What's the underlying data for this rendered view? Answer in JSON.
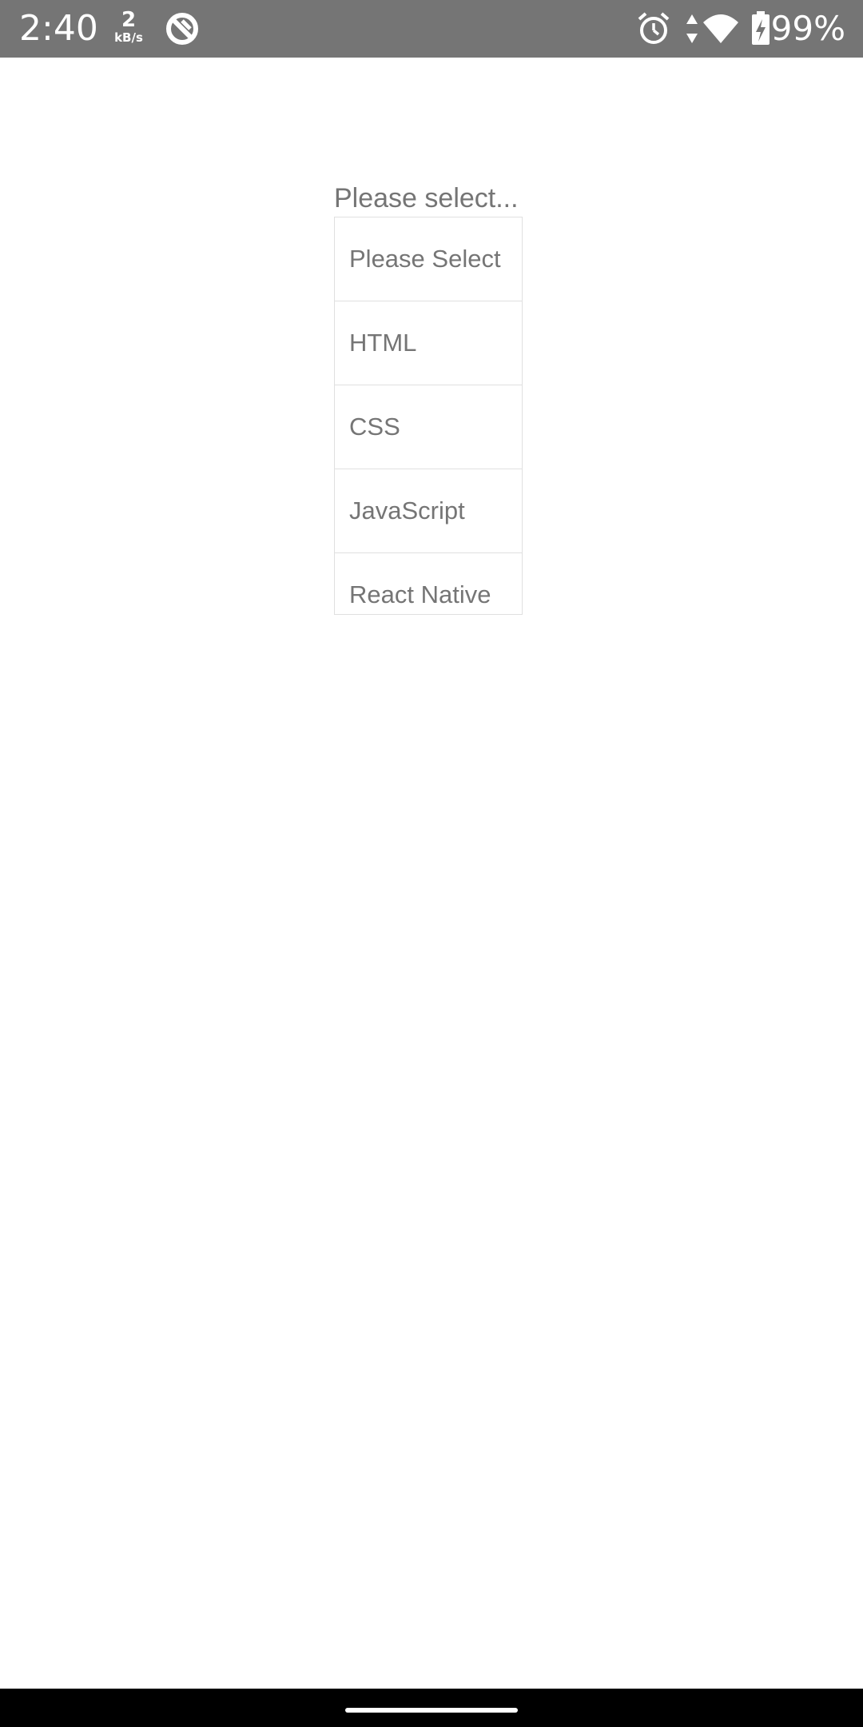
{
  "status_bar": {
    "time": "2:40",
    "net_speed_value": "2",
    "net_speed_unit": "kB/s",
    "battery_percent": "99%",
    "icons": [
      "data-saver-icon",
      "alarm-icon",
      "data-arrows-icon",
      "wifi-icon",
      "battery-charging-icon"
    ],
    "color_bg": "#757575"
  },
  "picker": {
    "label": "Please select...",
    "options": [
      "Please Select",
      "HTML",
      "CSS",
      "JavaScript",
      "React Native"
    ],
    "text_color": "#757575",
    "border_color": "#e0e0e0"
  }
}
